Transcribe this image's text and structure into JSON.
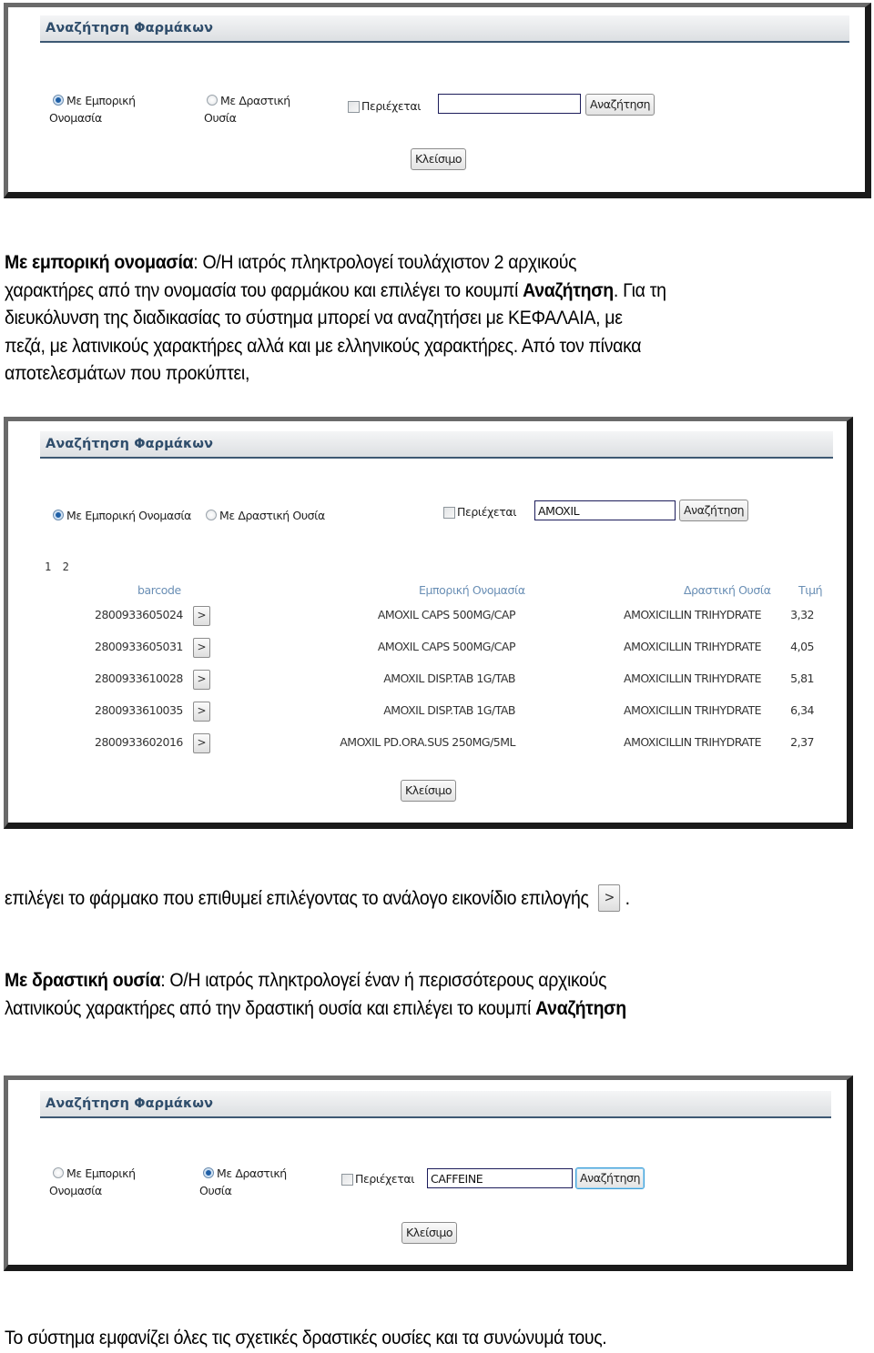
{
  "screens": {
    "initial": {
      "title": "Αναζήτηση Φαρμάκων",
      "radio_trade_name": {
        "label_line1": "Με Εμπορική",
        "label_line2": "Ονομασία",
        "selected": true
      },
      "radio_active_substance": {
        "label_line1": "Με Δραστική",
        "label_line2": "Ουσία",
        "selected": false
      },
      "contains_checkbox": {
        "label": "Περιέχεται",
        "checked": false
      },
      "search_input": {
        "value": ""
      },
      "search_button": "Αναζήτηση",
      "close_button": "Κλείσιμο"
    },
    "results": {
      "title": "Αναζήτηση Φαρμάκων",
      "radio_trade_name": {
        "label": "Με Εμπορική Ονομασία",
        "selected": true
      },
      "radio_active_substance": {
        "label": "Με Δραστική Ουσία",
        "selected": false
      },
      "contains_checkbox": {
        "label": "Περιέχεται",
        "checked": false
      },
      "search_input": {
        "value": "AMOXIL"
      },
      "search_button": "Αναζήτηση",
      "pagination": [
        "1",
        "2"
      ],
      "columns": {
        "barcode": "barcode",
        "trade_name": "Εμπορική Ονομασία",
        "active_substance": "Δραστική Ουσία",
        "price": "Τιμή"
      },
      "select_button_label": ">",
      "rows": [
        {
          "barcode": "2800933605024",
          "trade_name": "AMOXIL CAPS 500MG/CAP",
          "active_substance": "AMOXICILLIN TRIHYDRATE",
          "price": "3,32"
        },
        {
          "barcode": "2800933605031",
          "trade_name": "AMOXIL CAPS 500MG/CAP",
          "active_substance": "AMOXICILLIN TRIHYDRATE",
          "price": "4,05"
        },
        {
          "barcode": "2800933610028",
          "trade_name": "AMOXIL DISP.TAB 1G/TAB",
          "active_substance": "AMOXICILLIN TRIHYDRATE",
          "price": "5,81"
        },
        {
          "barcode": "2800933610035",
          "trade_name": "AMOXIL DISP.TAB 1G/TAB",
          "active_substance": "AMOXICILLIN TRIHYDRATE",
          "price": "6,34"
        },
        {
          "barcode": "2800933602016",
          "trade_name": "AMOXIL PD.ORA.SUS 250MG/5ML",
          "active_substance": "AMOXICILLIN TRIHYDRATE",
          "price": "2,37"
        }
      ],
      "close_button": "Κλείσιμο"
    },
    "substance": {
      "title": "Αναζήτηση Φαρμάκων",
      "radio_trade_name": {
        "label_line1": "Με Εμπορική",
        "label_line2": "Ονομασία",
        "selected": false
      },
      "radio_active_substance": {
        "label_line1": "Με Δραστική",
        "label_line2": "Ουσία",
        "selected": true
      },
      "contains_checkbox": {
        "label": "Περιέχεται",
        "checked": false
      },
      "search_input": {
        "value": "CAFFEINE"
      },
      "search_button": "Αναζήτηση",
      "close_button": "Κλείσιμο"
    }
  },
  "text": {
    "p1": {
      "bold_lead": "Με εμπορική ονομασία",
      "line1_rest": ": Ο/Η ιατρός πληκτρολογεί τουλάχιστον 2 αρχικούς",
      "line2_start": "χαρακτήρες από την ονομασία του φαρμάκου και επιλέγει το κουμπί ",
      "line2_bold": "Αναζήτηση",
      "line2_end": ". Για τη",
      "line3": "διευκόλυνση της διαδικασίας το σύστημα μπορεί να αναζητήσει με ΚΕΦΑΛΑΙΑ, με",
      "line4": "πεζά, με λατινικούς χαρακτήρες αλλά και με ελληνικούς χαρακτήρες. Από τον πίνακα",
      "line5": "αποτελεσμάτων που προκύπτει,"
    },
    "p2": {
      "text": "επιλέγει το φάρμακο που επιθυμεί επιλέγοντας το ανάλογο εικονίδιο επιλογής",
      "icon_label": ">",
      "end": "."
    },
    "p3": {
      "bold_lead": "Με δραστική ουσία",
      "line1_rest": ": Ο/Η ιατρός πληκτρολογεί έναν ή περισσότερους αρχικούς",
      "line2_start": "λατινικούς χαρακτήρες από την δραστική ουσία και επιλέγει το κουμπί ",
      "line2_bold": "Αναζήτηση"
    },
    "p4": "Το σύστημα εμφανίζει όλες τις σχετικές δραστικές ουσίες και τα συνώνυμά τους."
  }
}
